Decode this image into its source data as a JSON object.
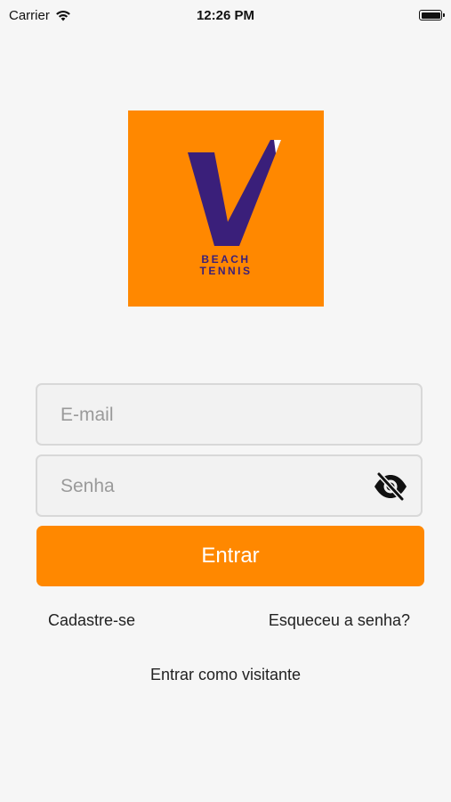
{
  "status_bar": {
    "carrier": "Carrier",
    "time": "12:26 PM"
  },
  "logo": {
    "line1": "BEACH",
    "line2": "TENNIS",
    "background_color": "#ff8800",
    "mark_color": "#3a1f7a"
  },
  "login_form": {
    "email_placeholder": "E-mail",
    "email_value": "",
    "password_placeholder": "Senha",
    "password_value": "",
    "password_toggle_icon": "eye-off-icon",
    "submit_label": "Entrar"
  },
  "links": {
    "register": "Cadastre-se",
    "forgot_password": "Esqueceu a senha?",
    "guest": "Entrar como visitante"
  },
  "colors": {
    "accent": "#ff8800",
    "background": "#f6f6f6"
  }
}
